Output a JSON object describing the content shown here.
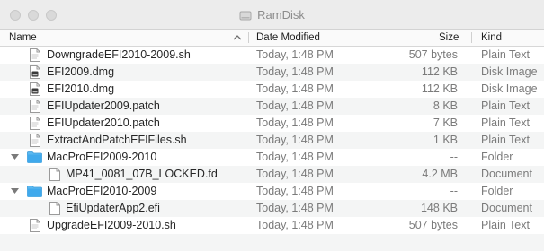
{
  "window": {
    "title": "RamDisk"
  },
  "columns": {
    "name": "Name",
    "date": "Date Modified",
    "size": "Size",
    "kind": "Kind"
  },
  "rows": [
    {
      "name": "DowngradeEFI2010-2009.sh",
      "date": "Today, 1:48 PM",
      "size": "507 bytes",
      "kind": "Plain Text",
      "icon": "document-icon"
    },
    {
      "name": "EFI2009.dmg",
      "date": "Today, 1:48 PM",
      "size": "112 KB",
      "kind": "Disk Image",
      "icon": "disk-image-icon"
    },
    {
      "name": "EFI2010.dmg",
      "date": "Today, 1:48 PM",
      "size": "112 KB",
      "kind": "Disk Image",
      "icon": "disk-image-icon"
    },
    {
      "name": "EFIUpdater2009.patch",
      "date": "Today, 1:48 PM",
      "size": "8 KB",
      "kind": "Plain Text",
      "icon": "document-icon"
    },
    {
      "name": "EFIUpdater2010.patch",
      "date": "Today, 1:48 PM",
      "size": "7 KB",
      "kind": "Plain Text",
      "icon": "document-icon"
    },
    {
      "name": "ExtractAndPatchEFIFiles.sh",
      "date": "Today, 1:48 PM",
      "size": "1 KB",
      "kind": "Plain Text",
      "icon": "document-icon"
    },
    {
      "name": "MacProEFI2009-2010",
      "date": "Today, 1:48 PM",
      "size": "--",
      "kind": "Folder",
      "icon": "folder-icon",
      "expanded": true
    },
    {
      "name": "MP41_0081_07B_LOCKED.fd",
      "date": "Today, 1:48 PM",
      "size": "4.2 MB",
      "kind": "Document",
      "icon": "document-icon",
      "child": true
    },
    {
      "name": "MacProEFI2010-2009",
      "date": "Today, 1:48 PM",
      "size": "--",
      "kind": "Folder",
      "icon": "folder-icon",
      "expanded": true
    },
    {
      "name": "EfiUpdaterApp2.efi",
      "date": "Today, 1:48 PM",
      "size": "148 KB",
      "kind": "Document",
      "icon": "document-icon",
      "child": true
    },
    {
      "name": "UpgradeEFI2009-2010.sh",
      "date": "Today, 1:48 PM",
      "size": "507 bytes",
      "kind": "Plain Text",
      "icon": "document-icon"
    }
  ],
  "colors": {
    "folder": "#3fa9ec",
    "stripe": "#f4f5f5",
    "secondary_text": "#7b7b7b"
  }
}
